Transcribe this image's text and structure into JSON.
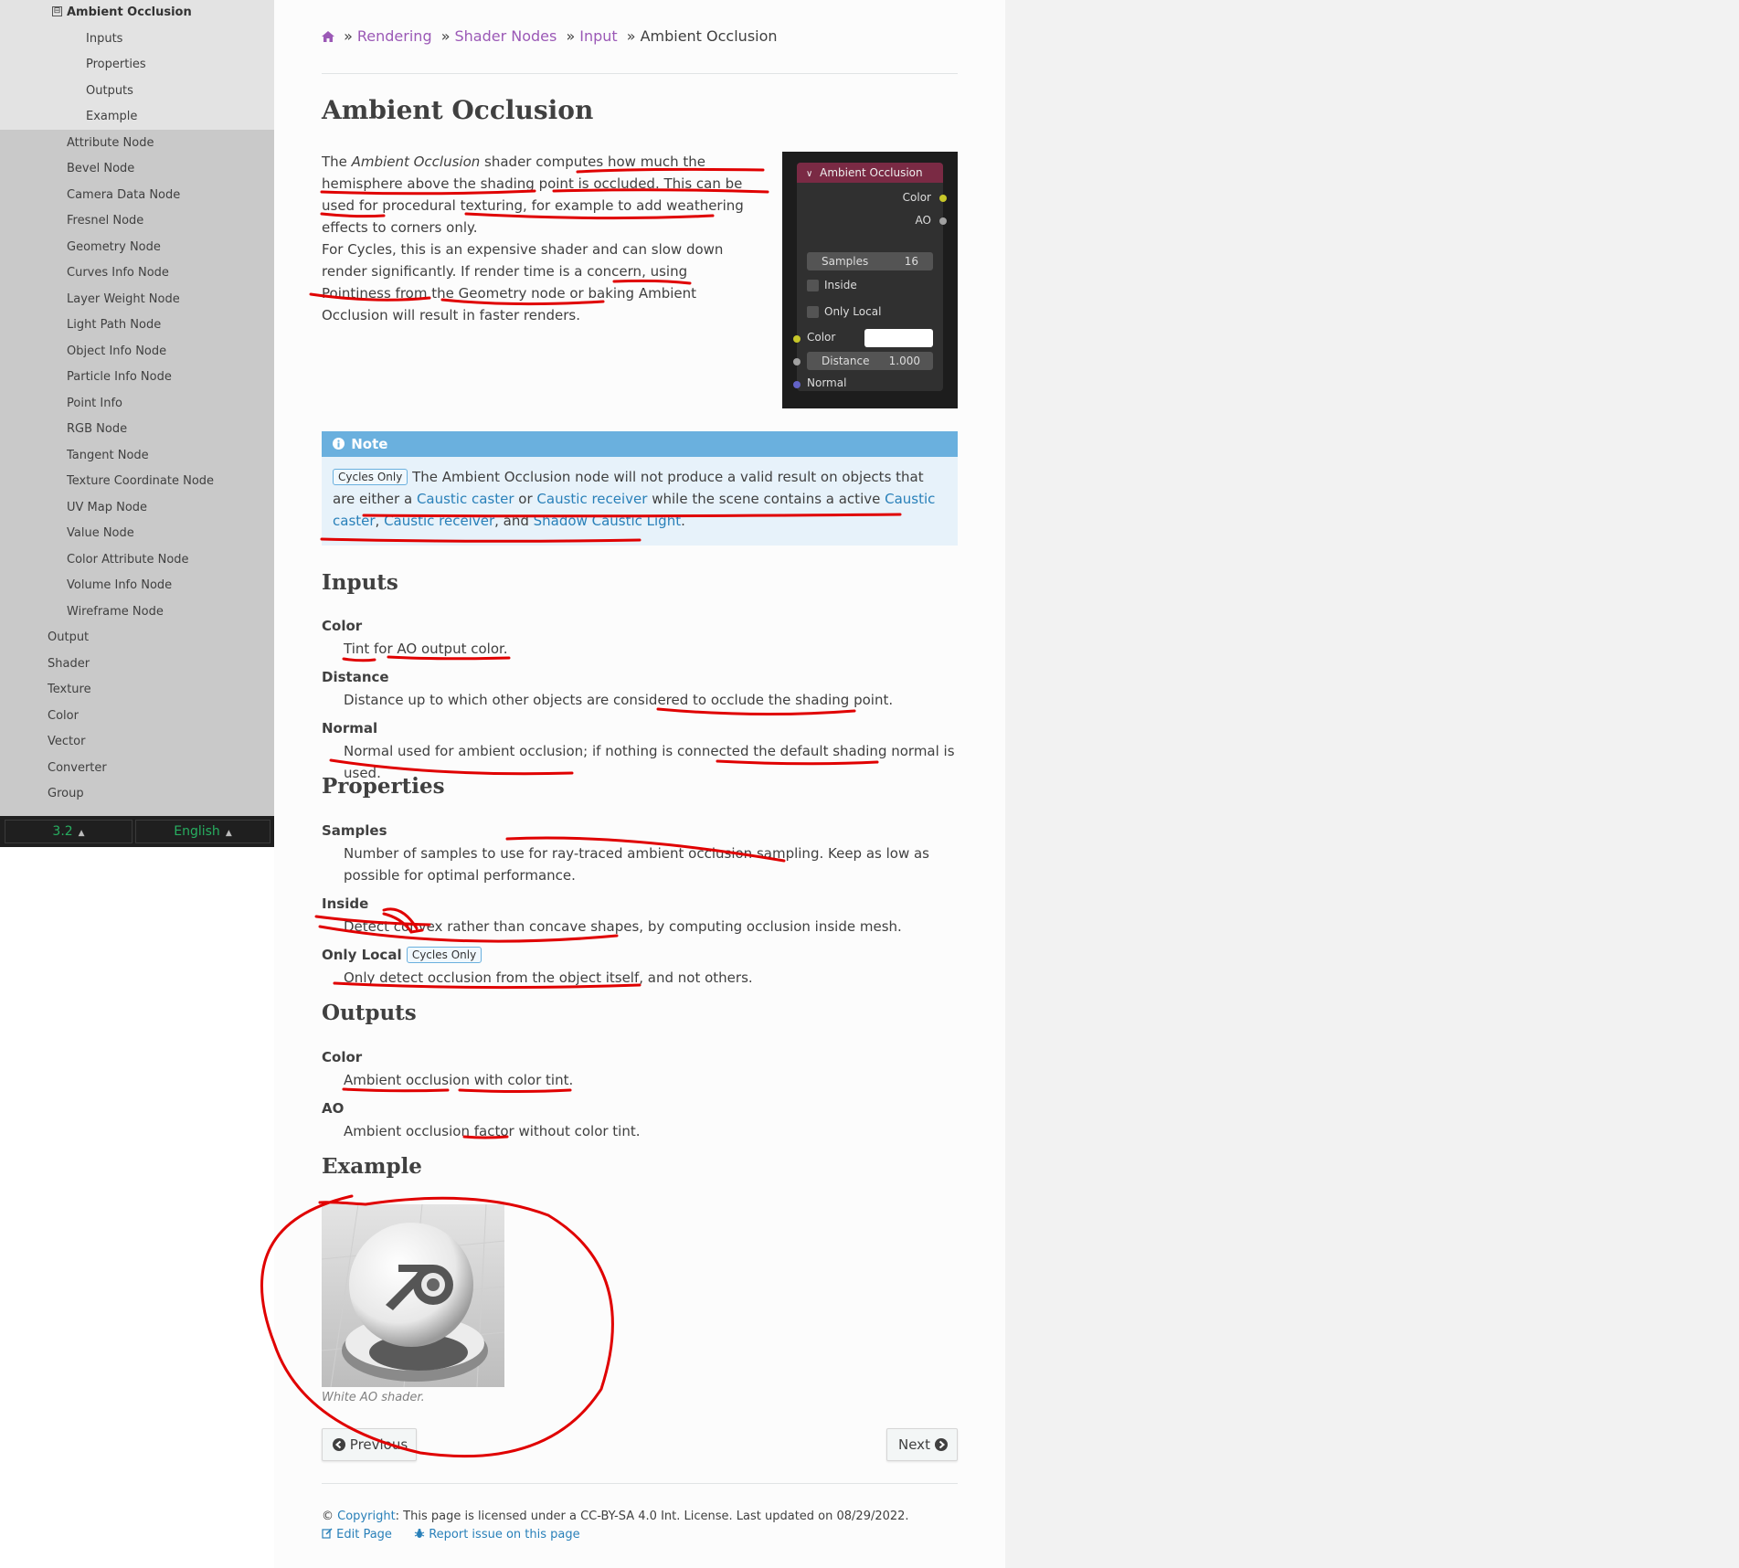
{
  "sidebar": {
    "current": "Ambient Occlusion",
    "toggle_symbol": "⊟",
    "subsections": [
      "Inputs",
      "Properties",
      "Outputs",
      "Example"
    ],
    "nodes": [
      "Attribute Node",
      "Bevel Node",
      "Camera Data Node",
      "Fresnel Node",
      "Geometry Node",
      "Curves Info Node",
      "Layer Weight Node",
      "Light Path Node",
      "Object Info Node",
      "Particle Info Node",
      "Point Info",
      "RGB Node",
      "Tangent Node",
      "Texture Coordinate Node",
      "UV Map Node",
      "Value Node",
      "Color Attribute Node",
      "Volume Info Node",
      "Wireframe Node"
    ],
    "categories": [
      "Output",
      "Shader",
      "Texture",
      "Color",
      "Vector",
      "Converter",
      "Group"
    ],
    "version": "3.2",
    "language": "English"
  },
  "breadcrumb": {
    "home_icon": "home-icon",
    "items": [
      "Rendering",
      "Shader Nodes",
      "Input"
    ],
    "current": "Ambient Occlusion",
    "separator": "»"
  },
  "title": "Ambient Occlusion",
  "intro": {
    "p1_pre": "The ",
    "p1_em": "Ambient Occlusion",
    "p1_post": " shader computes how much the hemisphere above the shading point is occluded. This can be used for procedural texturing, for example to add weathering effects to corners only.",
    "p2": "For Cycles, this is an expensive shader and can slow down render significantly. If render time is a concern, using Pointiness from the Geometry node or baking Ambient Occlusion will result in faster renders."
  },
  "node": {
    "header": "Ambient Occlusion",
    "out_color": "Color",
    "out_ao": "AO",
    "samples_label": "Samples",
    "samples_value": "16",
    "inside": "Inside",
    "only_local": "Only Local",
    "in_color": "Color",
    "distance_label": "Distance",
    "distance_value": "1.000",
    "normal": "Normal",
    "colors": {
      "header": "#7a2a44",
      "socket_color": "#c7c729",
      "socket_gray": "#a1a1a1",
      "socket_normal": "#6363c7"
    }
  },
  "note": {
    "title": "Note",
    "badge": "Cycles Only",
    "t1": " The Ambient Occlusion node will not produce a valid result on objects that are either a ",
    "l1": "Caustic caster",
    "t2": " or ",
    "l2": "Caustic receiver",
    "t3": " while the scene contains a active ",
    "l3": "Caustic caster",
    "t4": ", ",
    "l4": "Caustic receiver",
    "t5": ", and ",
    "l5": "Shadow Caustic Light",
    "t6": "."
  },
  "inputs": {
    "heading": "Inputs",
    "color_term": "Color",
    "color_desc": "Tint for AO output color.",
    "distance_term": "Distance",
    "distance_desc": "Distance up to which other objects are considered to occlude the shading point.",
    "normal_term": "Normal",
    "normal_desc": "Normal used for ambient occlusion; if nothing is connected the default shading normal is used."
  },
  "properties": {
    "heading": "Properties",
    "samples_term": "Samples",
    "samples_desc": "Number of samples to use for ray-traced ambient occlusion sampling. Keep as low as possible for optimal performance.",
    "inside_term": "Inside",
    "inside_desc": "Detect convex rather than concave shapes, by computing occlusion inside mesh.",
    "only_local_term": "Only Local",
    "only_local_badge": "Cycles Only",
    "only_local_desc": "Only detect occlusion from the object itself, and not others."
  },
  "outputs": {
    "heading": "Outputs",
    "color_term": "Color",
    "color_desc": "Ambient occlusion with color tint.",
    "ao_term": "AO",
    "ao_desc": "Ambient occlusion factor without color tint."
  },
  "example": {
    "heading": "Example",
    "caption": "White AO shader."
  },
  "nav": {
    "previous": "Previous",
    "next": "Next"
  },
  "footer": {
    "copyright_symbol": "©",
    "copyright_link": "Copyright",
    "license_text": ": This page is licensed under a CC-BY-SA 4.0 Int. License. Last updated on 08/29/2022.",
    "edit": "Edit Page",
    "report": "Report issue on this page"
  },
  "colors": {
    "link": "#2980b9",
    "breadcrumb_link": "#9b59b6",
    "note_head": "#6ab0de",
    "note_bg": "#e7f2fa",
    "annotation": "#e00000"
  }
}
